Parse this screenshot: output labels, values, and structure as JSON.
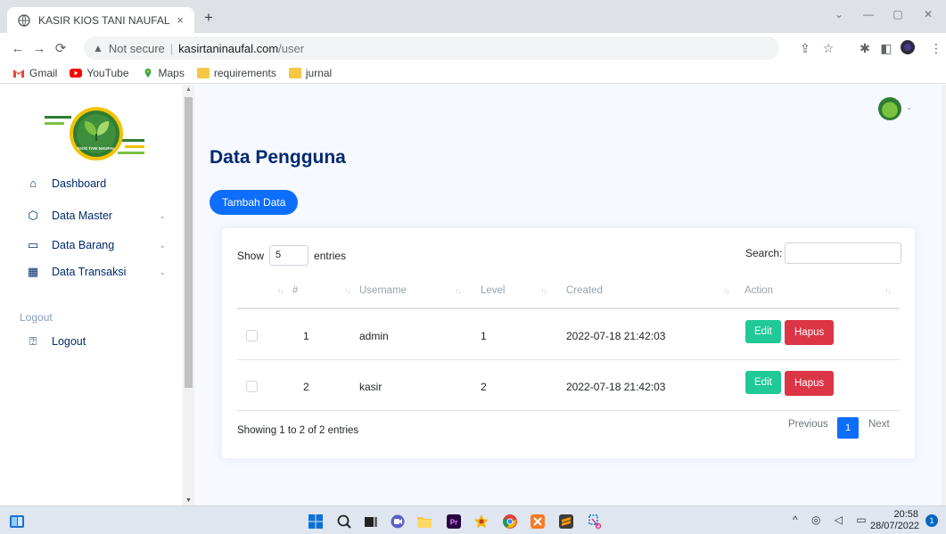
{
  "browser": {
    "tab_title": "KASIR KIOS TANI NAUFAL",
    "tab_close": "×",
    "new_tab": "+",
    "security_label": "Not secure",
    "url_host": "kasirtaninaufal.com",
    "url_path": "/user",
    "bookmarks": [
      {
        "label": "Gmail",
        "icon": "gmail-icon"
      },
      {
        "label": "YouTube",
        "icon": "youtube-icon"
      },
      {
        "label": "Maps",
        "icon": "maps-icon"
      },
      {
        "label": "requirements",
        "icon": "folder-icon"
      },
      {
        "label": "jurnal",
        "icon": "folder-icon"
      }
    ]
  },
  "sidebar": {
    "items": [
      {
        "label": "Dashboard",
        "icon": "home-icon"
      },
      {
        "label": "Data Master",
        "icon": "box-icon"
      },
      {
        "label": "Data Barang",
        "icon": "layout-icon"
      },
      {
        "label": "Data Transaksi",
        "icon": "grid-icon"
      }
    ],
    "section_heading": "Logout",
    "logout_label": "Logout",
    "logo_text": "KIOS TANI NAUFAL"
  },
  "main": {
    "title": "Data Pengguna",
    "add_button": "Tambah Data"
  },
  "table": {
    "show_label": "Show",
    "page_length": "5",
    "entries_label": "entries",
    "search_label": "Search:",
    "columns": [
      "#",
      "Username",
      "Level",
      "Created",
      "Action"
    ],
    "rows": [
      {
        "no": "1",
        "username": "admin",
        "level": "1",
        "created": "2022-07-18 21:42:03"
      },
      {
        "no": "2",
        "username": "kasir",
        "level": "2",
        "created": "2022-07-18 21:42:03"
      }
    ],
    "edit_label": "Edit",
    "delete_label": "Hapus",
    "info": "Showing 1 to 2 of 2 entries",
    "prev_label": "Previous",
    "current_page": "1",
    "next_label": "Next"
  },
  "taskbar": {
    "time": "20:58",
    "date": "28/07/2022",
    "notification_count": "1"
  },
  "colors": {
    "primary": "#0d6efd",
    "edit": "#20c997",
    "delete": "#dc3545",
    "title": "#012970"
  }
}
